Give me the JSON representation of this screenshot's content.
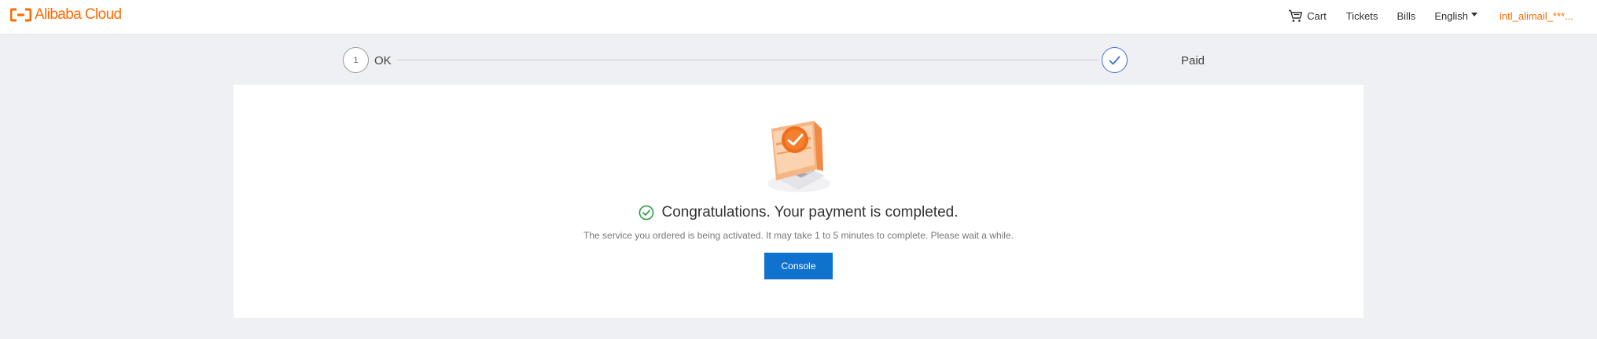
{
  "header": {
    "logo_text": "Alibaba Cloud",
    "logo_icon": "alibaba-cloud-logo-icon",
    "brand_color": "#ff6a00",
    "nav": {
      "cart_label": "Cart",
      "tickets_label": "Tickets",
      "bills_label": "Bills",
      "language_label": "English",
      "user_label": "intl_alimail_***..."
    }
  },
  "steps": [
    {
      "number": "1",
      "label": "OK",
      "state": "done"
    },
    {
      "label": "Paid",
      "state": "current",
      "icon": "checkmark-icon"
    }
  ],
  "result": {
    "headline": "Congratulations. Your payment is completed.",
    "message": "The service you ordered is being activated. It may take 1 to 5 minutes to complete. Please wait a while.",
    "button_label": "Console",
    "success_color": "#2e9e46",
    "button_color": "#0f72cf"
  }
}
